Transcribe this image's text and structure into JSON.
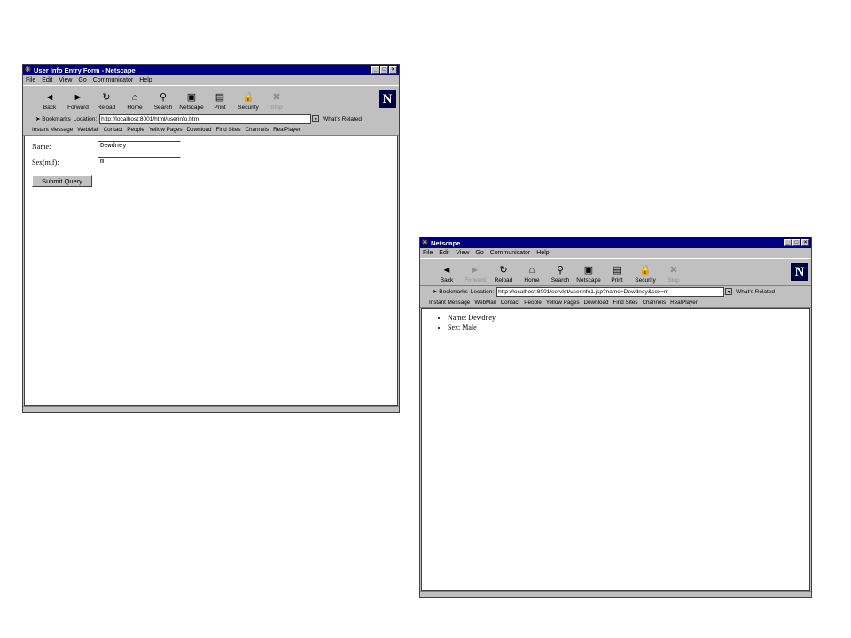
{
  "window1": {
    "title": "User Info Entry Form - Netscape",
    "menu": [
      "File",
      "Edit",
      "View",
      "Go",
      "Communicator",
      "Help"
    ],
    "toolbar": [
      {
        "label": "Back",
        "icon": "back-arrow-icon",
        "glyph": "◄"
      },
      {
        "label": "Forward",
        "icon": "forward-arrow-icon",
        "glyph": "►"
      },
      {
        "label": "Reload",
        "icon": "reload-icon",
        "glyph": "↻"
      },
      {
        "label": "Home",
        "icon": "home-icon",
        "glyph": "⌂"
      },
      {
        "label": "Search",
        "icon": "search-icon",
        "glyph": "⚲"
      },
      {
        "label": "Netscape",
        "icon": "netscape-icon",
        "glyph": "▣"
      },
      {
        "label": "Print",
        "icon": "print-icon",
        "glyph": "▤"
      },
      {
        "label": "Security",
        "icon": "lock-icon",
        "glyph": "🔒"
      },
      {
        "label": "Stop",
        "icon": "stop-icon",
        "glyph": "✖",
        "disabled": true
      }
    ],
    "bookmarks": "Bookmarks",
    "location_label": "Location:",
    "url": "http://localhost:8001/html/userinfo.html",
    "whats_related": "What's Related",
    "personal": [
      "Instant Message",
      "WebMail",
      "Contact",
      "People",
      "Yellow Pages",
      "Download",
      "Find Sites",
      "Channels",
      "RealPlayer"
    ],
    "form": {
      "name_label": "Name:",
      "name_value": "Dewdney",
      "sex_label": "Sex(m,f):",
      "sex_value": "m",
      "submit_label": "Submit Query"
    }
  },
  "window2": {
    "title": "Netscape",
    "menu": [
      "File",
      "Edit",
      "View",
      "Go",
      "Communicator",
      "Help"
    ],
    "toolbar": [
      {
        "label": "Back",
        "icon": "back-arrow-icon",
        "glyph": "◄"
      },
      {
        "label": "Forward",
        "icon": "forward-arrow-icon",
        "glyph": "►",
        "disabled": true
      },
      {
        "label": "Reload",
        "icon": "reload-icon",
        "glyph": "↻"
      },
      {
        "label": "Home",
        "icon": "home-icon",
        "glyph": "⌂"
      },
      {
        "label": "Search",
        "icon": "search-icon",
        "glyph": "⚲"
      },
      {
        "label": "Netscape",
        "icon": "netscape-icon",
        "glyph": "▣"
      },
      {
        "label": "Print",
        "icon": "print-icon",
        "glyph": "▤"
      },
      {
        "label": "Security",
        "icon": "lock-icon",
        "glyph": "🔒"
      },
      {
        "label": "Stop",
        "icon": "stop-icon",
        "glyph": "✖",
        "disabled": true
      }
    ],
    "bookmarks": "Bookmarks",
    "location_label": "Location:",
    "url": "http://localhost:8001/servlet/userinfo1.jsp?name=Dewdney&sex=m",
    "whats_related": "What's Related",
    "personal": [
      "Instant Message",
      "WebMail",
      "Contact",
      "People",
      "Yellow Pages",
      "Download",
      "Find Sites",
      "Channels",
      "RealPlayer"
    ],
    "results": [
      "Name: Dewdney",
      "Sex: Male"
    ]
  },
  "colors": {
    "title_bar": "#000080",
    "chrome": "#c0c0c0",
    "content": "#ffffff"
  }
}
